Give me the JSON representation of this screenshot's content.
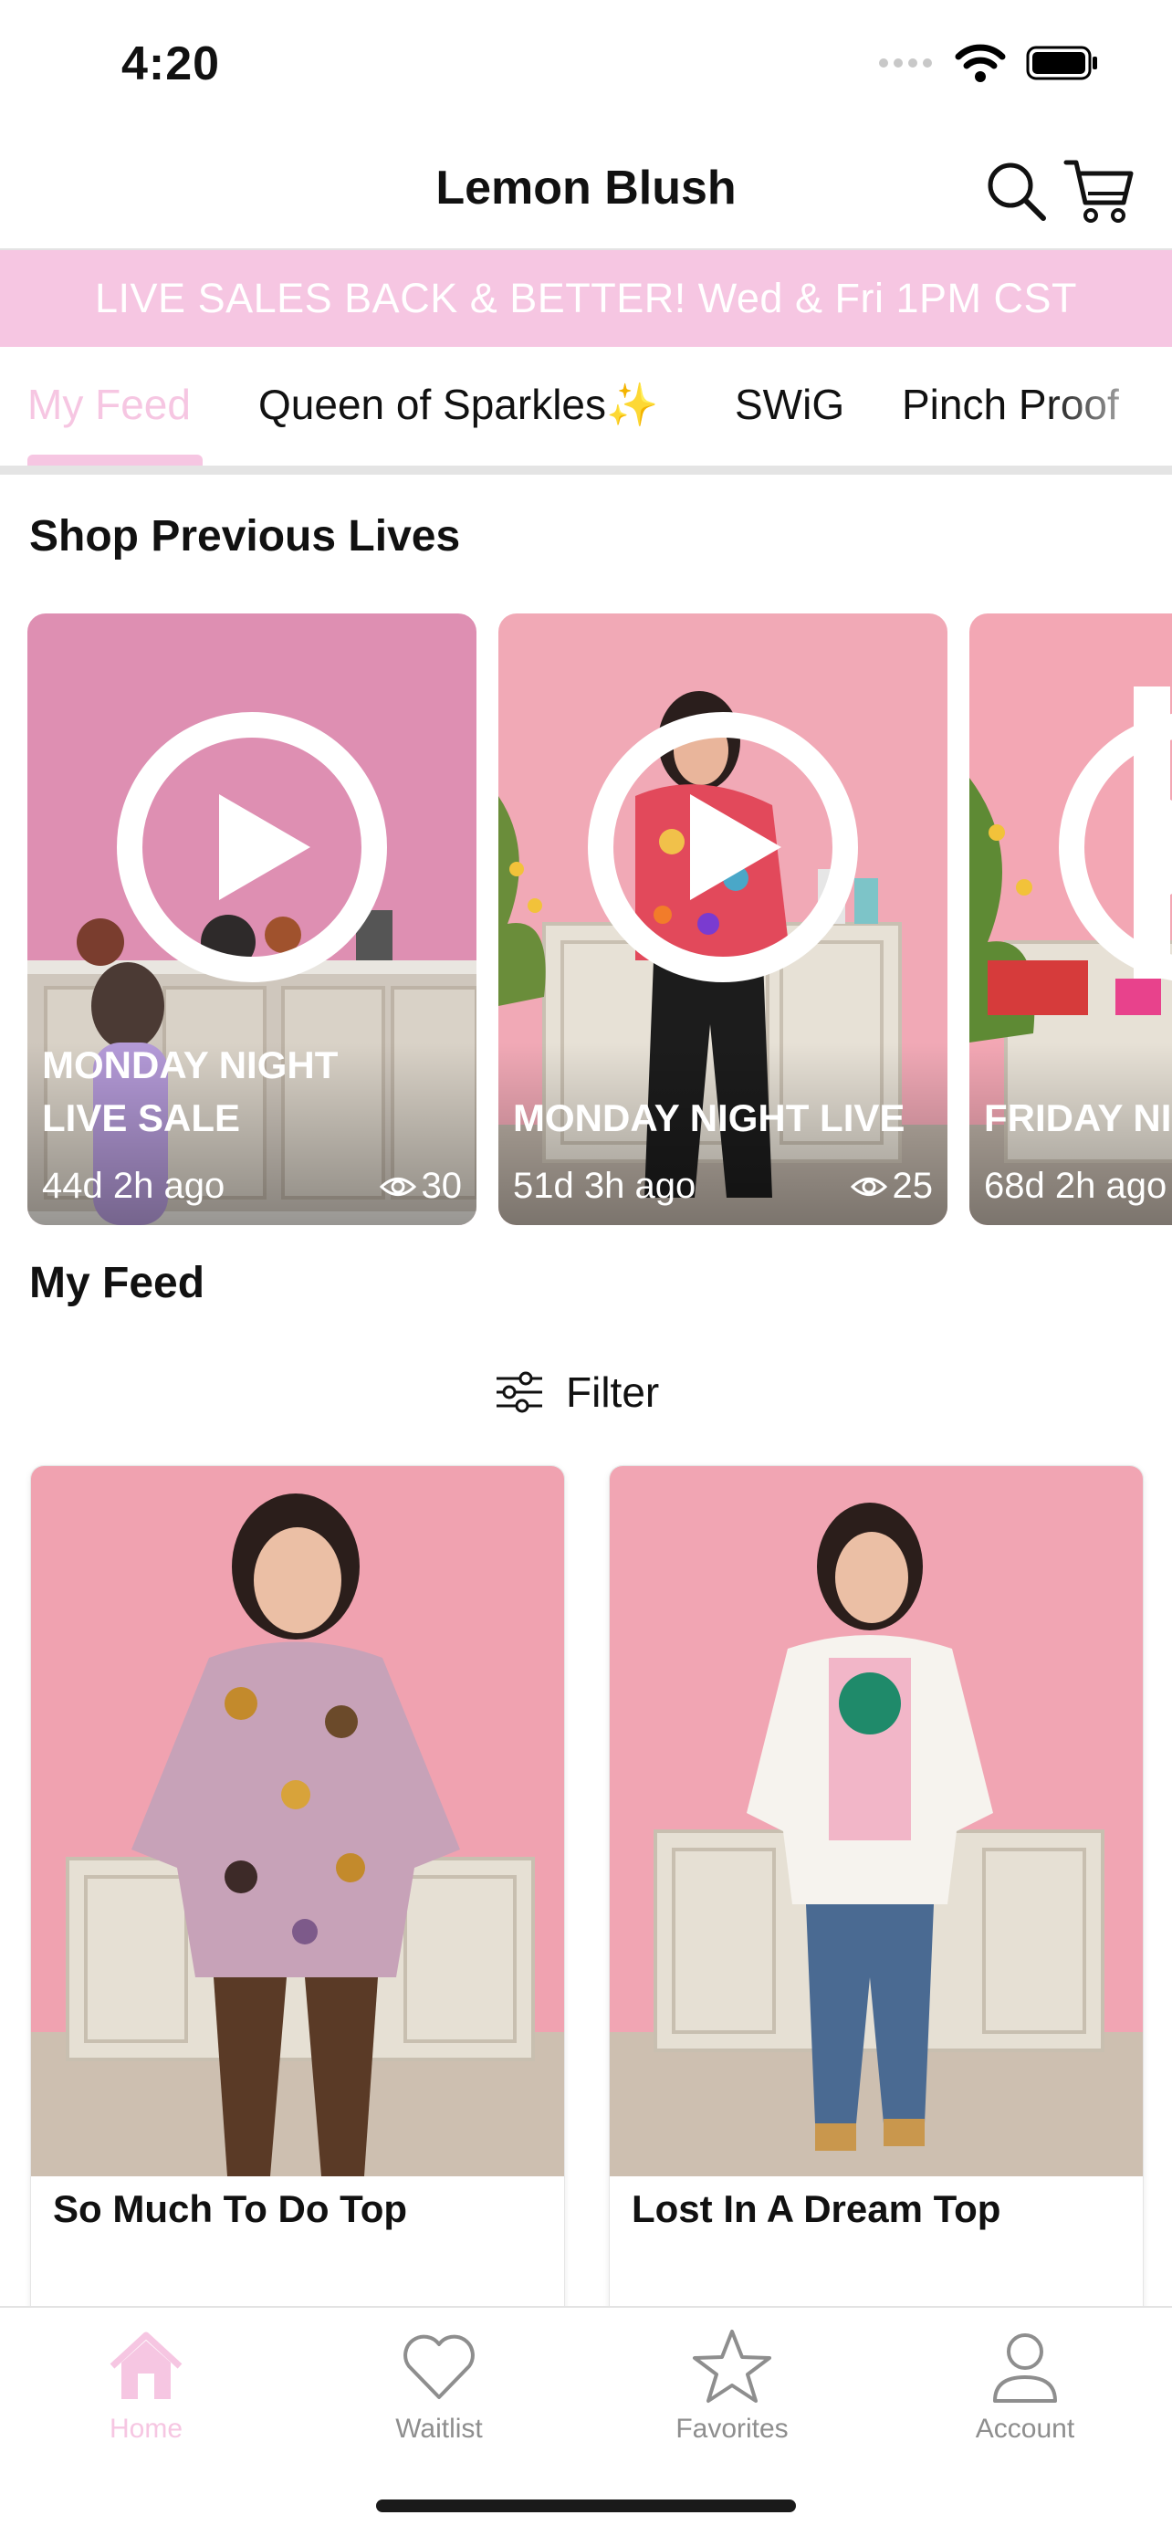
{
  "status_bar": {
    "time": "4:20"
  },
  "header": {
    "title": "Lemon Blush",
    "search_icon": "search-icon",
    "cart_icon": "cart-icon"
  },
  "banner": {
    "text": "LIVE SALES BACK & BETTER! Wed & Fri 1PM CST"
  },
  "tabs": [
    {
      "label": "My Feed",
      "active": true
    },
    {
      "label": "Queen of Sparkles✨",
      "active": false
    },
    {
      "label": "SWiG",
      "active": false
    },
    {
      "label": "Pinch Proof",
      "active": false
    }
  ],
  "previous_lives": {
    "heading": "Shop Previous Lives",
    "items": [
      {
        "title": "MONDAY NIGHT\nLIVE SALE",
        "ago": "44d 2h ago",
        "views": "30"
      },
      {
        "title": "MONDAY NIGHT LIVE",
        "ago": "51d 3h ago",
        "views": "25"
      },
      {
        "title": "FRIDAY NI",
        "ago": "68d 2h ago",
        "views": ""
      }
    ]
  },
  "feed": {
    "heading": "My Feed",
    "filter_label": "Filter",
    "products": [
      {
        "name": "So Much To Do Top"
      },
      {
        "name": "Lost In A Dream Top"
      }
    ]
  },
  "bottom_nav": [
    {
      "label": "Home",
      "icon": "home-icon",
      "active": true
    },
    {
      "label": "Waitlist",
      "icon": "heart-icon",
      "active": false
    },
    {
      "label": "Favorites",
      "icon": "star-icon",
      "active": false
    },
    {
      "label": "Account",
      "icon": "account-icon",
      "active": false
    }
  ],
  "colors": {
    "accent_pink": "#f6c6e2",
    "wall_pink": "#f0a6b4",
    "text": "#111111",
    "muted": "#8e8e8e"
  }
}
